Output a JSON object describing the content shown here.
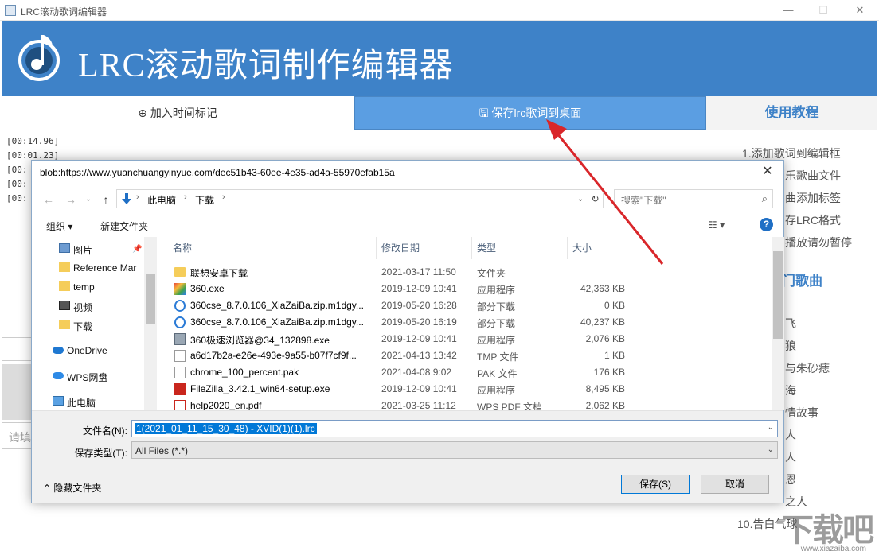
{
  "window": {
    "title": "LRC滚动歌词编辑器",
    "minimize": "—",
    "maximize": "☐",
    "close": "✕"
  },
  "banner": {
    "title": "LRC滚动歌词制作编辑器"
  },
  "toolbar": {
    "add_time_label": "加入时间标记",
    "save_label": "保存lrc歌词到桌面",
    "tutorial_label": "使用教程"
  },
  "lyrics": [
    "[00:14.96]",
    "[00:01.23]",
    "[00:",
    "[00:",
    "[00:"
  ],
  "input": {
    "placeholder": "请填"
  },
  "sidebar": {
    "steps": [
      "1.添加歌词到编辑框",
      "乐歌曲文件",
      "曲添加标签",
      "存LRC格式",
      "播放请勿暂停"
    ],
    "hot_title": "门歌曲",
    "songs": [
      "飞",
      "狼",
      "与朱砂痣",
      "海",
      "情故事",
      "人",
      "人",
      "恩",
      "之人",
      "10.告白气球"
    ]
  },
  "watermark": {
    "text": "下载吧",
    "url": "www.xiazaiba.com"
  },
  "dialog": {
    "title": "blob:https://www.yuanchuangyinyue.com/dec51b43-60ee-4e35-ad4a-55970efab15a",
    "close": "✕",
    "nav": {
      "back": "←",
      "forward": "→",
      "recent": "⌄",
      "up": "↑",
      "refresh": "↻",
      "dropdown": "⌄"
    },
    "breadcrumb": [
      "此电脑",
      "下载"
    ],
    "breadcrumb_sep": "›",
    "search_placeholder": "搜索\"下载\"",
    "commands": {
      "organize": "组织 ▾",
      "new_folder": "新建文件夹",
      "view": "☷ ▾",
      "help": "?"
    },
    "nav_pane": [
      {
        "label": "图片",
        "icon": "pictures-icon"
      },
      {
        "label": "Reference Mar",
        "icon": "folder-icon"
      },
      {
        "label": "temp",
        "icon": "folder-icon"
      },
      {
        "label": "视频",
        "icon": "video-icon"
      },
      {
        "label": "下载",
        "icon": "folder-icon"
      },
      {
        "label": "OneDrive",
        "icon": "cloud-icon"
      },
      {
        "label": "WPS网盘",
        "icon": "cloud-icon"
      },
      {
        "label": "此电脑",
        "icon": "computer-icon"
      }
    ],
    "columns": {
      "name": "名称",
      "date": "修改日期",
      "type": "类型",
      "size": "大小"
    },
    "files": [
      {
        "name": "联想安卓下载",
        "date": "2021-03-17 11:50",
        "type": "文件夹",
        "size": "",
        "icon": "folder-icon"
      },
      {
        "name": "360.exe",
        "date": "2019-12-09 10:41",
        "type": "应用程序",
        "size": "42,363 KB",
        "icon": "app-icon"
      },
      {
        "name": "360cse_8.7.0.106_XiaZaiBa.zip.m1dgy...",
        "date": "2019-05-20 16:28",
        "type": "部分下载",
        "size": "0 KB",
        "icon": "ie-icon"
      },
      {
        "name": "360cse_8.7.0.106_XiaZaiBa.zip.m1dgy...",
        "date": "2019-05-20 16:19",
        "type": "部分下载",
        "size": "40,237 KB",
        "icon": "ie-icon"
      },
      {
        "name": "360极速浏览器@34_132898.exe",
        "date": "2019-12-09 10:41",
        "type": "应用程序",
        "size": "2,076 KB",
        "icon": "installer-icon"
      },
      {
        "name": "a6d17b2a-e26e-493e-9a55-b07f7cf9f...",
        "date": "2021-04-13 13:42",
        "type": "TMP 文件",
        "size": "1 KB",
        "icon": "file-icon"
      },
      {
        "name": "chrome_100_percent.pak",
        "date": "2021-04-08 9:02",
        "type": "PAK 文件",
        "size": "176 KB",
        "icon": "file-icon"
      },
      {
        "name": "FileZilla_3.42.1_win64-setup.exe",
        "date": "2019-12-09 10:41",
        "type": "应用程序",
        "size": "8,495 KB",
        "icon": "filezilla-icon"
      },
      {
        "name": "help2020_en.pdf",
        "date": "2021-03-25 11:12",
        "type": "WPS PDF 文档",
        "size": "2,062 KB",
        "icon": "pdf-icon"
      }
    ],
    "filename_label": "文件名(N):",
    "filename_value": "1(2021_01_11_15_30_48) - XVID(1)(1).lrc",
    "filetype_label": "保存类型(T):",
    "filetype_value": "All Files (*.*)",
    "hide_folders": "隐藏文件夹",
    "save_button": "保存(S)",
    "cancel_button": "取消"
  },
  "colors": {
    "banner": "#3e82c8",
    "save_button_bg": "#5b9ee2",
    "arrow": "#d9262a",
    "selection": "#0078d7"
  }
}
